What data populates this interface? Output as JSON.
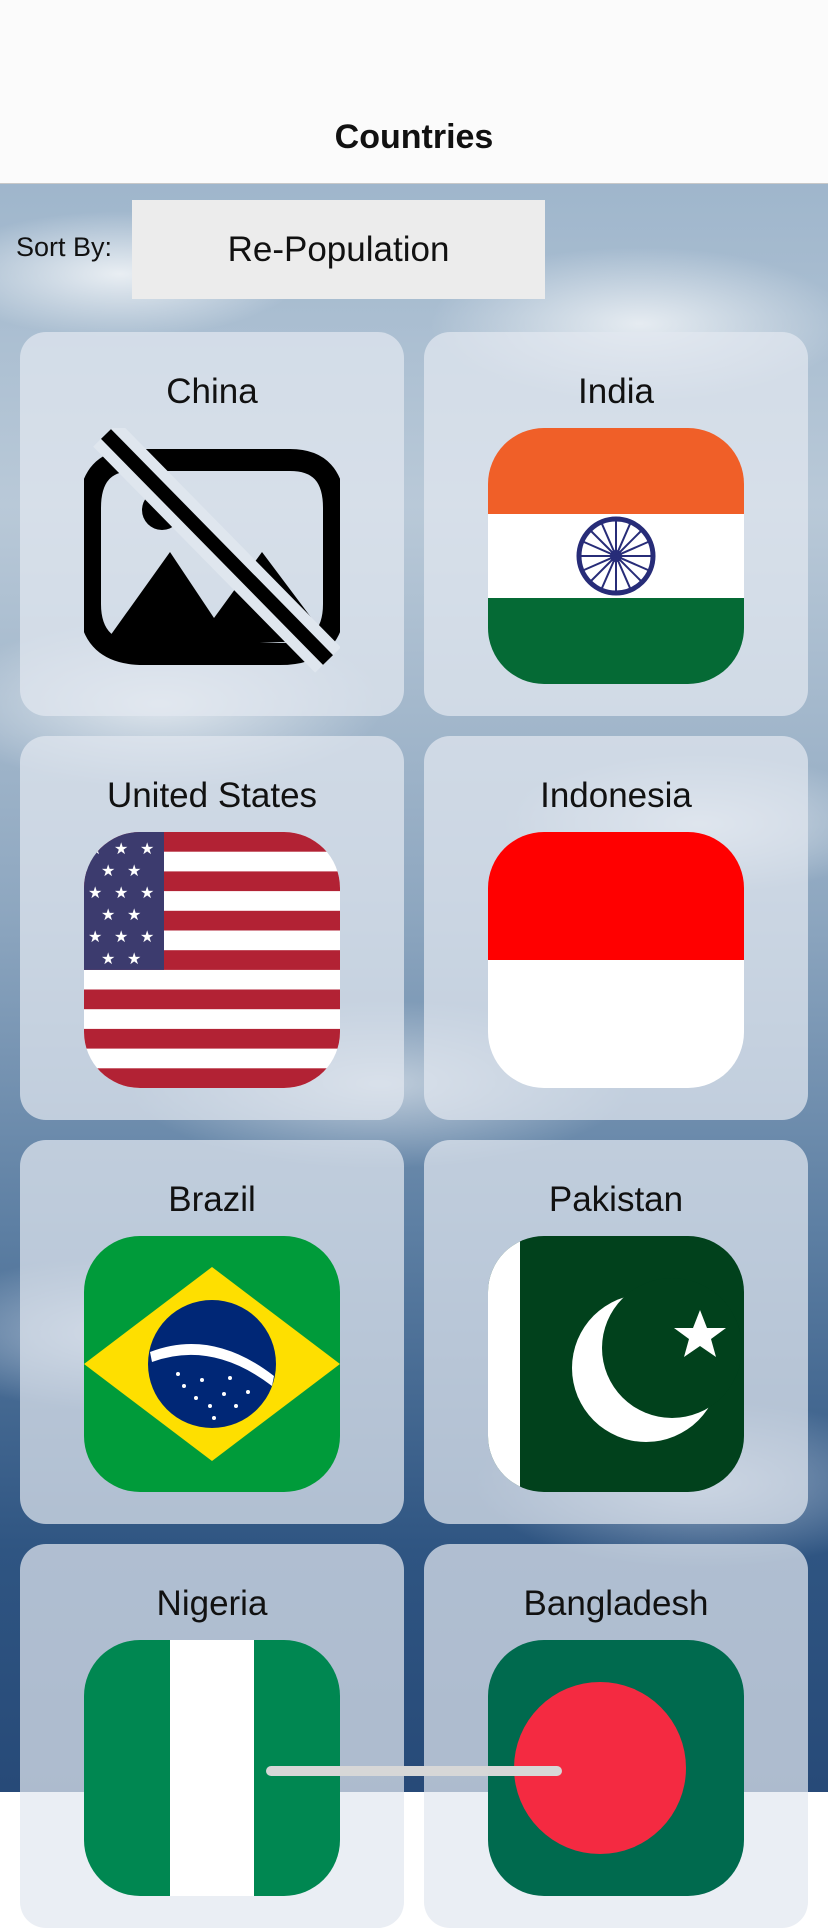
{
  "nav": {
    "title": "Countries"
  },
  "sort": {
    "label": "Sort By:",
    "value": "Re-Population"
  },
  "countries": [
    {
      "name": "China",
      "flag": "image-unavailable-icon"
    },
    {
      "name": "India",
      "flag": "india-flag"
    },
    {
      "name": "United States",
      "flag": "united-states-flag"
    },
    {
      "name": "Indonesia",
      "flag": "indonesia-flag"
    },
    {
      "name": "Brazil",
      "flag": "brazil-flag"
    },
    {
      "name": "Pakistan",
      "flag": "pakistan-flag"
    },
    {
      "name": "Nigeria",
      "flag": "nigeria-flag"
    },
    {
      "name": "Bangladesh",
      "flag": "bangladesh-flag"
    }
  ],
  "colors": {
    "india_saffron": "#f05f28",
    "india_green": "#056a35",
    "india_chakra": "#272c78",
    "us_red": "#b22234",
    "us_blue": "#3c3b6e",
    "indonesia_red": "#ff0000",
    "brazil_green": "#009b3a",
    "brazil_yellow": "#fedf00",
    "brazil_blue": "#002776",
    "pakistan_green": "#01411c",
    "nigeria_green": "#008751",
    "bangladesh_green": "#006a4e",
    "bangladesh_red": "#f42a41"
  }
}
